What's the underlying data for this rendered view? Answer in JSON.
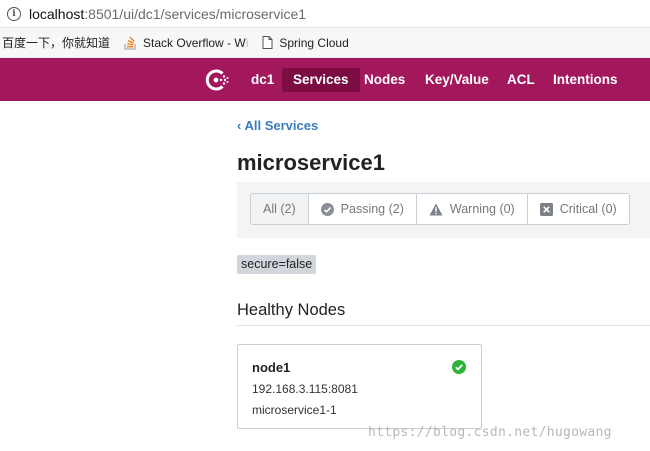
{
  "browser": {
    "url_host": "localhost",
    "url_path": ":8501/ui/dc1/services/microservice1",
    "bookmarks": [
      {
        "label": "百度一下，你就知道",
        "icon": "none"
      },
      {
        "label": "Stack Overflow - W",
        "label_fade": "i",
        "icon": "stackoverflow-icon"
      },
      {
        "label": "Spring Cloud",
        "icon": "page-icon"
      }
    ]
  },
  "nav": {
    "datacenter": "dc1",
    "items": [
      {
        "label": "Services",
        "active": true
      },
      {
        "label": "Nodes"
      },
      {
        "label": "Key/Value"
      },
      {
        "label": "ACL"
      },
      {
        "label": "Intentions"
      }
    ],
    "brand_color": "#a3185c"
  },
  "main": {
    "back_link": "All Services",
    "service_name": "microservice1",
    "filters": [
      {
        "label": "All (2)",
        "icon": "none",
        "active": true
      },
      {
        "label": "Passing (2)",
        "icon": "check-circle-icon"
      },
      {
        "label": "Warning (0)",
        "icon": "warning-triangle-icon"
      },
      {
        "label": "Critical (0)",
        "icon": "x-square-icon"
      }
    ],
    "tag": "secure=false",
    "section_title": "Healthy Nodes",
    "nodes": [
      {
        "name": "node1",
        "address": "192.168.3.115:8081",
        "service_id": "microservice1-1",
        "status_color": "#2eb039"
      }
    ]
  },
  "watermark": "https://blog.csdn.net/hugowang"
}
